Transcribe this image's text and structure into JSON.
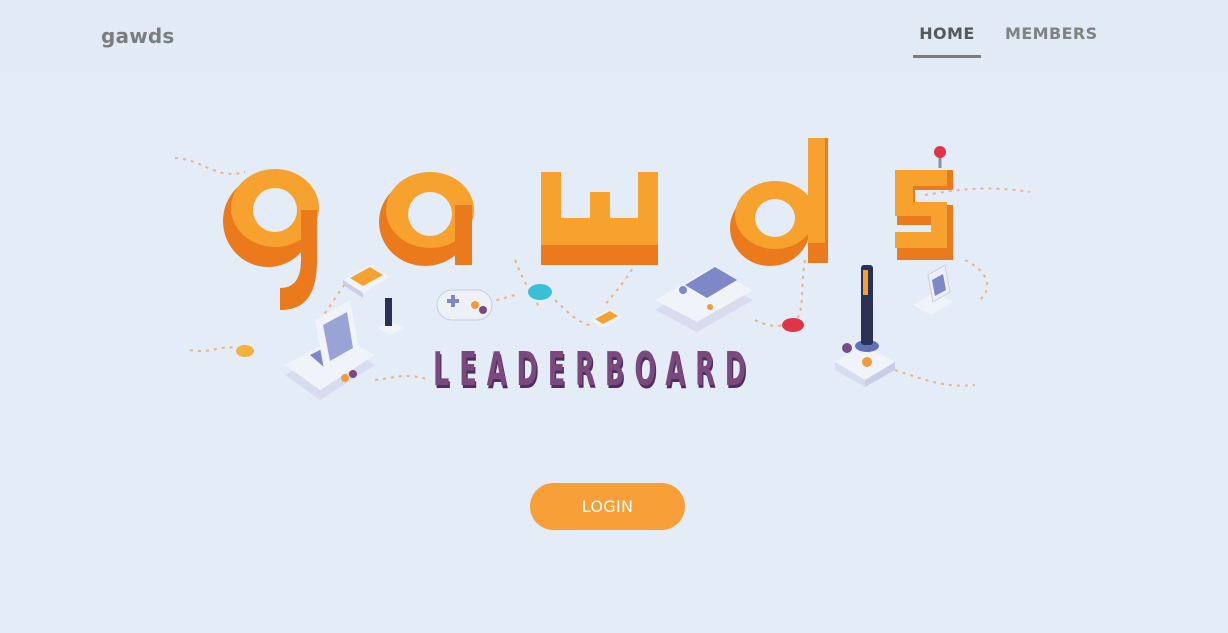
{
  "navbar": {
    "brand": "gawds",
    "items": [
      {
        "label": "HOME",
        "active": true
      },
      {
        "label": "MEMBERS",
        "active": false
      }
    ]
  },
  "hero": {
    "logo_text": "gawds",
    "subtitle": "LEADERBOARD",
    "colors": {
      "letters_front": "#f7a12e",
      "letters_side": "#ea7a1c",
      "subtitle": "#7a4a7e",
      "device_body": "#eef0f8",
      "screen": "#7e88c6"
    }
  },
  "login": {
    "label": "LOGIN",
    "color": "#f99f38"
  }
}
